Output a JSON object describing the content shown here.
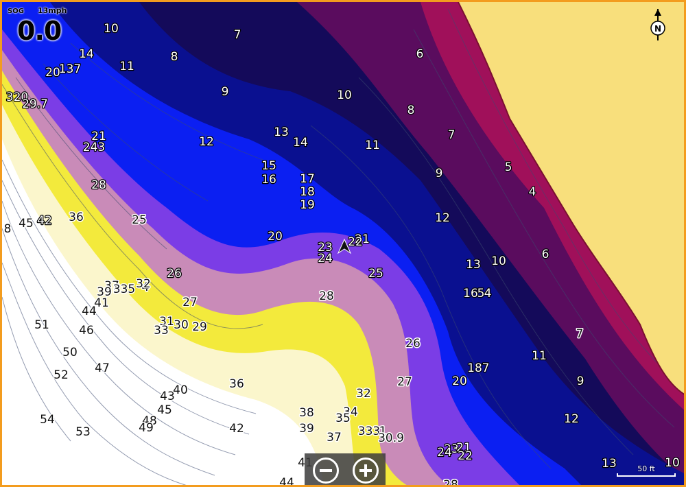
{
  "sog": {
    "label": "SOG",
    "value": "0.0",
    "speed_readout": "13",
    "unit": "mph"
  },
  "north": {
    "label": "N"
  },
  "scale": {
    "label": "50 ft"
  },
  "zoom": {
    "out_icon": "minus-icon",
    "in_icon": "plus-icon"
  },
  "colors": {
    "land": "#f8df7c",
    "frame": "#f39c1e",
    "deep_white": "#ffffff",
    "yellow": "#f3ea3c",
    "violet": "#8a4fe0",
    "blue": "#0a1cf0",
    "navy": "#0a0f5e",
    "purple": "#4a0a5a",
    "crimson": "#a0105a"
  },
  "depth_labels": [
    "10",
    "7",
    "6",
    "14",
    "11",
    "8",
    "20",
    "137",
    "9",
    "10",
    "8",
    "320",
    "29.7",
    "7",
    "13",
    "14",
    "11",
    "12",
    "21",
    "243",
    "5",
    "9",
    "15",
    "16",
    "17",
    "4",
    "18",
    "28",
    "19",
    "12",
    "45",
    "42",
    "36",
    "25",
    "20",
    "21",
    "22",
    "23",
    "24",
    "6",
    "13",
    "10",
    "25",
    "37",
    "39",
    "335",
    "4",
    "32",
    "28",
    "16",
    "5",
    "4",
    "44",
    "41",
    "27",
    "26",
    "8",
    "51",
    "46",
    "31",
    "30",
    "29",
    "33",
    "7",
    "50",
    "47",
    "11",
    "52",
    "36",
    "18",
    "7",
    "20",
    "9",
    "26",
    "27",
    "43",
    "40",
    "45",
    "32",
    "54",
    "53",
    "48",
    "49",
    "42",
    "38",
    "39",
    "34",
    "35",
    "37",
    "333",
    "1",
    "30.9",
    "12",
    "23",
    "21",
    "24",
    "22",
    "13",
    "10",
    "41",
    "44",
    "28"
  ]
}
